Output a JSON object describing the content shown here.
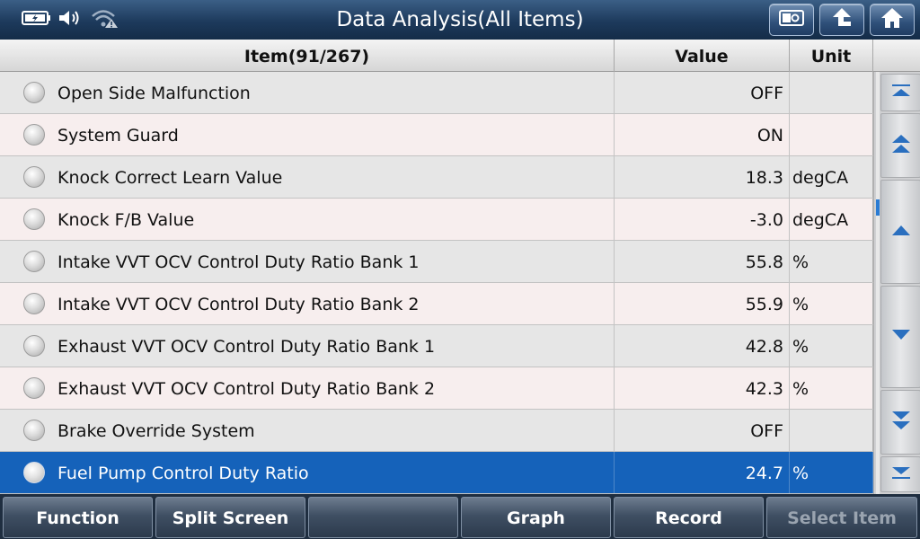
{
  "title": "Data Analysis(All Items)",
  "status_icons": [
    "battery-icon",
    "speaker-icon",
    "wifi-warning-icon"
  ],
  "toolbar_icons": [
    "screenshot-icon",
    "back-up-icon",
    "home-icon"
  ],
  "table": {
    "headers": {
      "item": "Item(91/267)",
      "value": "Value",
      "unit": "Unit"
    },
    "rows": [
      {
        "item": "Open Side Malfunction",
        "value": "OFF",
        "unit": ""
      },
      {
        "item": "System Guard",
        "value": "ON",
        "unit": ""
      },
      {
        "item": "Knock Correct Learn Value",
        "value": "18.3",
        "unit": "degCA"
      },
      {
        "item": "Knock F/B Value",
        "value": "-3.0",
        "unit": "degCA"
      },
      {
        "item": "Intake VVT OCV Control Duty Ratio Bank 1",
        "value": "55.8",
        "unit": "%"
      },
      {
        "item": "Intake VVT OCV Control Duty Ratio Bank 2",
        "value": "55.9",
        "unit": "%"
      },
      {
        "item": "Exhaust VVT OCV Control Duty Ratio Bank 1",
        "value": "42.8",
        "unit": "%"
      },
      {
        "item": "Exhaust VVT OCV Control Duty Ratio Bank 2",
        "value": "42.3",
        "unit": "%"
      },
      {
        "item": "Brake Override System",
        "value": "OFF",
        "unit": ""
      },
      {
        "item": "Fuel Pump Control Duty Ratio",
        "value": "24.7",
        "unit": "%"
      }
    ],
    "selected_row": 9
  },
  "scroll": {
    "buttons": [
      "scroll-top-icon",
      "page-up-icon",
      "line-up-icon",
      "line-down-icon",
      "page-down-icon",
      "scroll-bottom-icon"
    ],
    "thumb_color": "#2b7bd3"
  },
  "bottom_bar": {
    "function": "Function",
    "split_screen": "Split Screen",
    "blank": "",
    "graph": "Graph",
    "record": "Record",
    "select_item": "Select Item"
  },
  "colors": {
    "title_bar": "#1d3a5c",
    "selected_row": "#1562ba",
    "bottom_bar": "#1f2e40"
  }
}
